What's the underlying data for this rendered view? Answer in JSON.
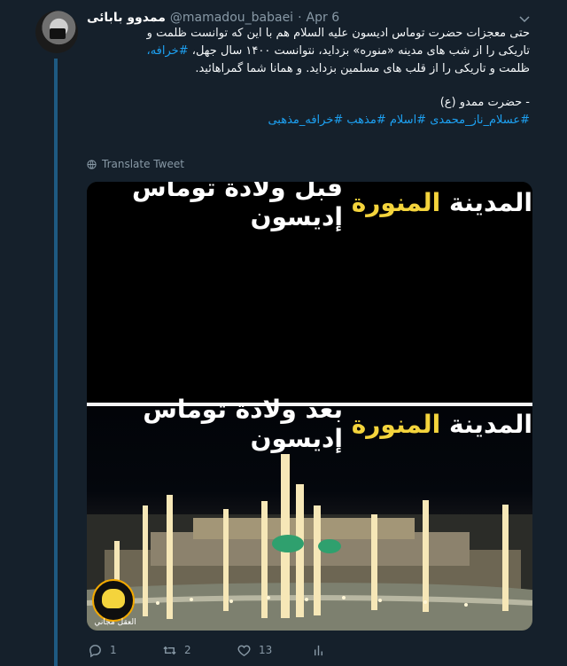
{
  "tweet": {
    "author_name": "ممدوو بابائی",
    "handle": "@mamadou_babaei",
    "separator": "·",
    "date": "Apr 6",
    "body_lines": [
      "حتی معجزات حضرت توماس ادیسون علیه السلام هم با این که توانست ظلمت و",
      "تاریکی را از شب های مدینه «منوره» بزداید، نتوانست ۱۴۰۰ سال جهل، ",
      "ظلمت و تاریکی را از قلب های مسلمین بزداید. و همانا شما گمراهائید."
    ],
    "inline_hashtag": "#خرافه،",
    "signature": "- حضرت ممدو (ع)",
    "hashtags": [
      "#عسلام_ناز_محمدی",
      "#اسلام",
      "#مذهب",
      "#خرافه_مذهبی"
    ],
    "translate_label": "Translate Tweet",
    "reply_count": "1",
    "retweet_count": "2",
    "like_count": "13"
  },
  "media": {
    "caption_top": [
      "المدينة",
      "المنورة",
      "قبل ولادة توماس إديسون"
    ],
    "caption_bottom": [
      "المدينة",
      "المنورة",
      "بعد ولادة توماس إديسون"
    ],
    "logo_text": "العقل مجاني"
  },
  "icons": {
    "reply": "reply-icon",
    "retweet": "retweet-icon",
    "like": "heart-icon",
    "analytics": "analytics-icon",
    "translate": "globe-icon",
    "menu": "chevron-down-icon"
  },
  "colors": {
    "background": "#15202b",
    "accent": "#1da1f2",
    "muted": "#8899a6",
    "caption_yellow": "#f4d43c"
  }
}
